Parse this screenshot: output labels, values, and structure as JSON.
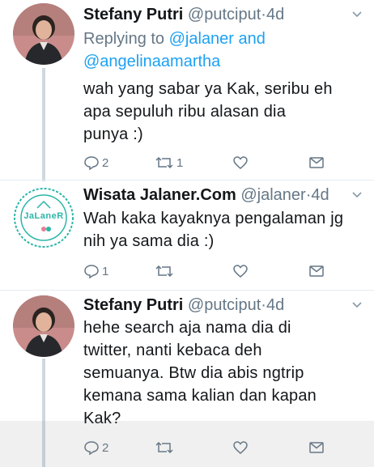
{
  "tweets": [
    {
      "name": "Stefany Putri",
      "handle": "@putciput",
      "time": "4d",
      "reply_prefix": "Replying to",
      "reply_user1": "@jalaner",
      "reply_and": "and",
      "reply_user2": "@angelinaamartha",
      "text_lines": [
        "wah yang sabar ya Kak, seribu eh",
        "apa sepuluh ribu alasan dia",
        "punya :)"
      ],
      "reply_count": "2",
      "retweet_count": "1"
    },
    {
      "name": "Wisata Jalaner.Com",
      "handle": "@jalaner",
      "time": "4d",
      "avatar_text": "JaLaneR",
      "text_lines": [
        "Wah kaka kayaknya pengalaman jg",
        "nih ya sama dia :)"
      ],
      "reply_count": "1",
      "retweet_count": ""
    },
    {
      "name": "Stefany Putri",
      "handle": "@putciput",
      "time": "4d",
      "text_lines": [
        "hehe search aja nama dia di",
        "twitter, nanti kebaca deh",
        "semuanya. Btw dia abis ngtrip",
        "kemana sama kalian dan kapan",
        "Kak?"
      ],
      "reply_count": "2",
      "retweet_count": ""
    }
  ],
  "separator_dot": "·",
  "colors": {
    "link": "#1da1f2",
    "muted": "#657786",
    "text": "#14171a",
    "jalaner_teal": "#2bb6a8"
  },
  "icons": [
    "reply-icon",
    "retweet-icon",
    "like-icon",
    "message-icon",
    "chevron-down-icon"
  ]
}
